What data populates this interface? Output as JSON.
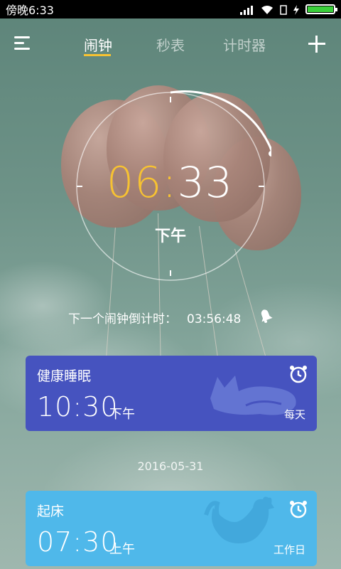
{
  "status": {
    "time": "傍晚6:33"
  },
  "tabs": [
    {
      "label": "闹钟",
      "active": true
    },
    {
      "label": "秒表",
      "active": false
    },
    {
      "label": "计时器",
      "active": false
    }
  ],
  "clock": {
    "hours": "06",
    "sep": ":",
    "minutes": "33",
    "ampm": "下午"
  },
  "countdown": {
    "label": "下一个闹钟倒计时：",
    "value": "03:56:48"
  },
  "alarms": [
    {
      "name": "健康睡眠",
      "time": "10:30",
      "ampm": "下午",
      "repeat": "每天",
      "color": "#4653bf"
    },
    {
      "name": "起床",
      "time": "07:30",
      "ampm": "上午",
      "repeat": "工作日",
      "color": "#4fb8ea"
    }
  ],
  "date_separator": "2016-05-31",
  "colors": {
    "accent": "#f7c232"
  }
}
